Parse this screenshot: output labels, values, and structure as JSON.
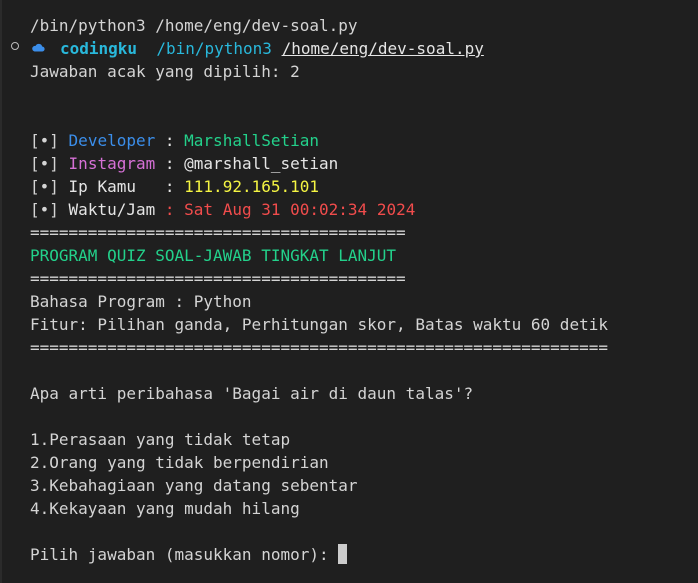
{
  "terminal": {
    "command_echo": "/bin/python3 /home/eng/dev-soal.py",
    "prompt_user": "codingku",
    "prompt_cmd_bin": "/bin/python3",
    "prompt_cmd_path": "/home/eng/dev-soal.py",
    "random_answer": "Jawaban acak yang dipilih: 2",
    "info": {
      "bullet": "[•]",
      "developer_label": "Developer",
      "developer_sep": " : ",
      "developer_value": "MarshallSetian",
      "instagram_label": "Instagram",
      "instagram_sep": " : ",
      "instagram_value": "@marshall_setian",
      "ip_label": "Ip Kamu  ",
      "ip_sep": " : ",
      "ip_value": "111.92.165.101",
      "time_label": "Waktu/Jam",
      "time_sep": " : ",
      "time_value": "Sat Aug 31 00:02:34 2024"
    },
    "separator_short": "=======================================",
    "program_title": "PROGRAM QUIZ SOAL-JAWAB TINGKAT LANJUT",
    "separator_mid": "=======================================",
    "language_line": "Bahasa Program : Python",
    "features_line": "Fitur: Pilihan ganda, Perhitungan skor, Batas waktu 60 detik",
    "separator_long": "============================================================",
    "question": "Apa arti peribahasa 'Bagai air di daun talas'?",
    "options": [
      "1.Perasaan yang tidak tetap",
      "2.Orang yang tidak berpendirian",
      "3.Kebahagiaan yang datang sebentar",
      "4.Kekayaan yang mudah hilang"
    ],
    "input_prompt": "Pilih jawaban (masukkan nomor): "
  },
  "colors": {
    "background": "#1f1f1f",
    "text": "#d4d4d4",
    "green": "#23d18b",
    "blue": "#3b8eea",
    "cyan": "#29b8db",
    "magenta": "#d670d6",
    "yellow": "#f5f543",
    "red": "#f14c4c"
  },
  "icons": {
    "prompt_marker": "circle-icon",
    "prompt_cloud": "cloud-icon"
  }
}
